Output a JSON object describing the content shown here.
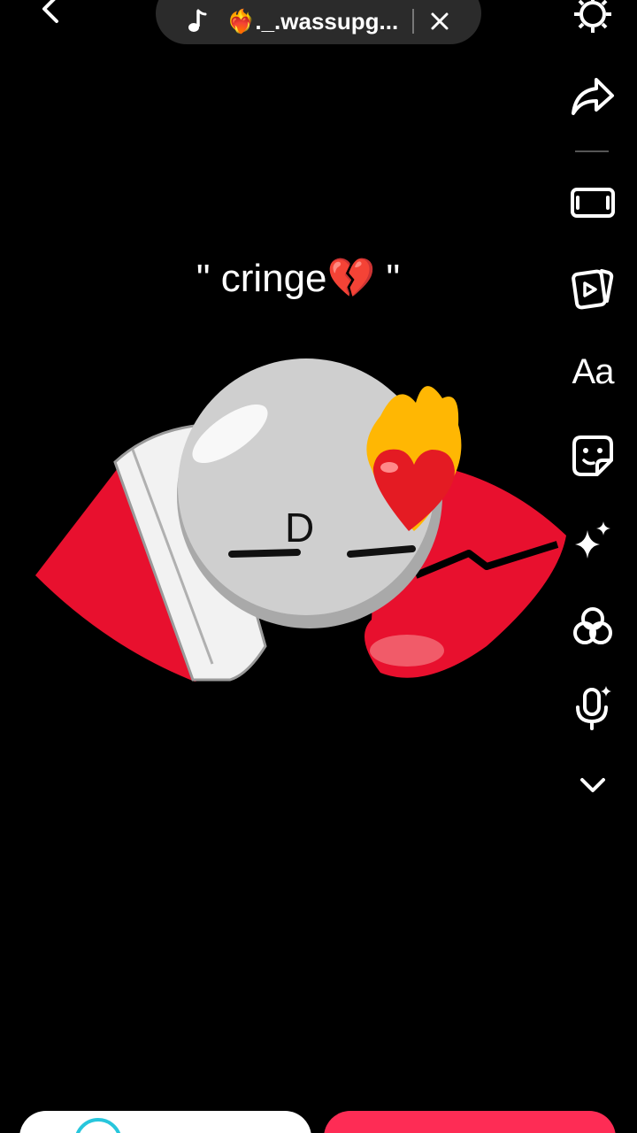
{
  "header": {
    "sound_title": "❤️‍🔥._.wassupg...",
    "icons": {
      "back": "arrow-left-icon",
      "music": "music-note-icon",
      "close": "close-icon",
      "settings": "gear-icon"
    }
  },
  "toolbar": {
    "text_tool_label": "Aa",
    "icons": [
      "share-arrow-icon",
      "aspect-ratio-icon",
      "templates-icon",
      "text-icon",
      "sticker-icon",
      "effects-sparkle-icon",
      "filters-icon",
      "voice-effects-icon",
      "chevron-down-icon"
    ]
  },
  "canvas": {
    "caption": "\" cringe💔 \"",
    "sticker_face_text": "_D_"
  },
  "colors": {
    "accent_red": "#fe2c55",
    "accent_cyan": "#27c6dc",
    "pill_bg": "#2b2b2b",
    "background": "#000000"
  }
}
